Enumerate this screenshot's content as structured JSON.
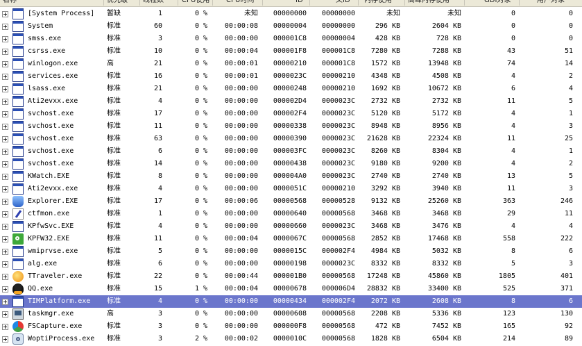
{
  "columns": [
    "名称",
    "优先级",
    "线程数",
    "CPU使用",
    "CPU时间",
    "ID",
    "父ID",
    "内存使用",
    "高峰内存使用",
    "GDI对象",
    "用户对象"
  ],
  "processes": [
    {
      "name": "[System Process]",
      "priority": "暂缺",
      "threads": "1",
      "cpu": "0 %",
      "cpu_time": "未知",
      "id": "00000000",
      "parent_id": "00000000",
      "mem": "未知",
      "peak_mem": "未知",
      "gdi": "0",
      "user": "0",
      "icon": "window-icon"
    },
    {
      "name": "System",
      "priority": "标准",
      "threads": "60",
      "cpu": "0 %",
      "cpu_time": "00:00:08",
      "id": "00000004",
      "parent_id": "00000000",
      "mem": "296 KB",
      "peak_mem": "2604 KB",
      "gdi": "0",
      "user": "0",
      "icon": "window-icon"
    },
    {
      "name": "smss.exe",
      "priority": "标准",
      "threads": "3",
      "cpu": "0 %",
      "cpu_time": "00:00:00",
      "id": "000001C8",
      "parent_id": "00000004",
      "mem": "428 KB",
      "peak_mem": "728 KB",
      "gdi": "0",
      "user": "0",
      "icon": "window-icon"
    },
    {
      "name": "csrss.exe",
      "priority": "标准",
      "threads": "10",
      "cpu": "0 %",
      "cpu_time": "00:00:04",
      "id": "000001F8",
      "parent_id": "000001C8",
      "mem": "7280 KB",
      "peak_mem": "7288 KB",
      "gdi": "43",
      "user": "51",
      "icon": "window-icon"
    },
    {
      "name": "winlogon.exe",
      "priority": "高",
      "threads": "21",
      "cpu": "0 %",
      "cpu_time": "00:00:01",
      "id": "00000210",
      "parent_id": "000001C8",
      "mem": "1572 KB",
      "peak_mem": "13948 KB",
      "gdi": "74",
      "user": "14",
      "icon": "window-icon"
    },
    {
      "name": "services.exe",
      "priority": "标准",
      "threads": "16",
      "cpu": "0 %",
      "cpu_time": "00:00:01",
      "id": "0000023C",
      "parent_id": "00000210",
      "mem": "4348 KB",
      "peak_mem": "4508 KB",
      "gdi": "4",
      "user": "2",
      "icon": "window-icon"
    },
    {
      "name": "lsass.exe",
      "priority": "标准",
      "threads": "21",
      "cpu": "0 %",
      "cpu_time": "00:00:00",
      "id": "00000248",
      "parent_id": "00000210",
      "mem": "1692 KB",
      "peak_mem": "10672 KB",
      "gdi": "6",
      "user": "4",
      "icon": "window-icon"
    },
    {
      "name": "Ati2evxx.exe",
      "priority": "标准",
      "threads": "4",
      "cpu": "0 %",
      "cpu_time": "00:00:00",
      "id": "000002D4",
      "parent_id": "0000023C",
      "mem": "2732 KB",
      "peak_mem": "2732 KB",
      "gdi": "11",
      "user": "5",
      "icon": "window-icon"
    },
    {
      "name": "svchost.exe",
      "priority": "标准",
      "threads": "17",
      "cpu": "0 %",
      "cpu_time": "00:00:00",
      "id": "000002F4",
      "parent_id": "0000023C",
      "mem": "5120 KB",
      "peak_mem": "5172 KB",
      "gdi": "4",
      "user": "1",
      "icon": "window-icon"
    },
    {
      "name": "svchost.exe",
      "priority": "标准",
      "threads": "11",
      "cpu": "0 %",
      "cpu_time": "00:00:00",
      "id": "00000338",
      "parent_id": "0000023C",
      "mem": "8948 KB",
      "peak_mem": "8956 KB",
      "gdi": "4",
      "user": "3",
      "icon": "window-icon"
    },
    {
      "name": "svchost.exe",
      "priority": "标准",
      "threads": "63",
      "cpu": "0 %",
      "cpu_time": "00:00:00",
      "id": "00000390",
      "parent_id": "0000023C",
      "mem": "21628 KB",
      "peak_mem": "22324 KB",
      "gdi": "11",
      "user": "25",
      "icon": "window-icon"
    },
    {
      "name": "svchost.exe",
      "priority": "标准",
      "threads": "6",
      "cpu": "0 %",
      "cpu_time": "00:00:00",
      "id": "000003FC",
      "parent_id": "0000023C",
      "mem": "8260 KB",
      "peak_mem": "8304 KB",
      "gdi": "4",
      "user": "1",
      "icon": "window-icon"
    },
    {
      "name": "svchost.exe",
      "priority": "标准",
      "threads": "14",
      "cpu": "0 %",
      "cpu_time": "00:00:00",
      "id": "00000438",
      "parent_id": "0000023C",
      "mem": "9180 KB",
      "peak_mem": "9200 KB",
      "gdi": "4",
      "user": "2",
      "icon": "window-icon"
    },
    {
      "name": "KWatch.EXE",
      "priority": "标准",
      "threads": "8",
      "cpu": "0 %",
      "cpu_time": "00:00:00",
      "id": "000004A0",
      "parent_id": "0000023C",
      "mem": "2740 KB",
      "peak_mem": "2740 KB",
      "gdi": "13",
      "user": "5",
      "icon": "window-icon"
    },
    {
      "name": "Ati2evxx.exe",
      "priority": "标准",
      "threads": "4",
      "cpu": "0 %",
      "cpu_time": "00:00:00",
      "id": "0000051C",
      "parent_id": "00000210",
      "mem": "3292 KB",
      "peak_mem": "3940 KB",
      "gdi": "11",
      "user": "3",
      "icon": "window-icon"
    },
    {
      "name": "Explorer.EXE",
      "priority": "标准",
      "threads": "17",
      "cpu": "0 %",
      "cpu_time": "00:00:06",
      "id": "00000568",
      "parent_id": "00000528",
      "mem": "9132 KB",
      "peak_mem": "25260 KB",
      "gdi": "363",
      "user": "246",
      "icon": "explorer-icon"
    },
    {
      "name": "ctfmon.exe",
      "priority": "标准",
      "threads": "1",
      "cpu": "0 %",
      "cpu_time": "00:00:00",
      "id": "00000640",
      "parent_id": "00000568",
      "mem": "3468 KB",
      "peak_mem": "3468 KB",
      "gdi": "29",
      "user": "11",
      "icon": "pen-icon"
    },
    {
      "name": "KPfwSvc.EXE",
      "priority": "标准",
      "threads": "4",
      "cpu": "0 %",
      "cpu_time": "00:00:00",
      "id": "00000660",
      "parent_id": "0000023C",
      "mem": "3468 KB",
      "peak_mem": "3476 KB",
      "gdi": "4",
      "user": "4",
      "icon": "window-icon"
    },
    {
      "name": "KPFW32.EXE",
      "priority": "标准",
      "threads": "11",
      "cpu": "0 %",
      "cpu_time": "00:00:04",
      "id": "0000067C",
      "parent_id": "00000568",
      "mem": "2852 KB",
      "peak_mem": "17468 KB",
      "gdi": "558",
      "user": "222",
      "icon": "firewall-icon"
    },
    {
      "name": "wmiprvse.exe",
      "priority": "标准",
      "threads": "5",
      "cpu": "0 %",
      "cpu_time": "00:00:00",
      "id": "0000015C",
      "parent_id": "000002F4",
      "mem": "4984 KB",
      "peak_mem": "5032 KB",
      "gdi": "8",
      "user": "6",
      "icon": "window-icon"
    },
    {
      "name": "alg.exe",
      "priority": "标准",
      "threads": "6",
      "cpu": "0 %",
      "cpu_time": "00:00:00",
      "id": "00000198",
      "parent_id": "0000023C",
      "mem": "8332 KB",
      "peak_mem": "8332 KB",
      "gdi": "5",
      "user": "3",
      "icon": "window-icon"
    },
    {
      "name": "TTraveler.exe",
      "priority": "标准",
      "threads": "22",
      "cpu": "0 %",
      "cpu_time": "00:00:44",
      "id": "000001B0",
      "parent_id": "00000568",
      "mem": "17248 KB",
      "peak_mem": "45860 KB",
      "gdi": "1805",
      "user": "401",
      "icon": "browser-icon"
    },
    {
      "name": "QQ.exe",
      "priority": "标准",
      "threads": "15",
      "cpu": "1 %",
      "cpu_time": "00:00:04",
      "id": "00000678",
      "parent_id": "000006D4",
      "mem": "28832 KB",
      "peak_mem": "33400 KB",
      "gdi": "525",
      "user": "371",
      "icon": "qq-penguin-icon"
    },
    {
      "name": "TIMPlatform.exe",
      "priority": "标准",
      "threads": "4",
      "cpu": "0 %",
      "cpu_time": "00:00:00",
      "id": "00000434",
      "parent_id": "000002F4",
      "mem": "2072 KB",
      "peak_mem": "2608 KB",
      "gdi": "8",
      "user": "6",
      "icon": "window-icon",
      "selected": true
    },
    {
      "name": "taskmgr.exe",
      "priority": "高",
      "threads": "3",
      "cpu": "0 %",
      "cpu_time": "00:00:00",
      "id": "00000608",
      "parent_id": "00000568",
      "mem": "2208 KB",
      "peak_mem": "5336 KB",
      "gdi": "123",
      "user": "130",
      "icon": "monitor-icon"
    },
    {
      "name": "FSCapture.exe",
      "priority": "标准",
      "threads": "3",
      "cpu": "0 %",
      "cpu_time": "00:00:00",
      "id": "000000F8",
      "parent_id": "00000568",
      "mem": "472 KB",
      "peak_mem": "7452 KB",
      "gdi": "165",
      "user": "92",
      "icon": "capture-icon"
    },
    {
      "name": "WoptiProcess.exe",
      "priority": "标准",
      "threads": "3",
      "cpu": "2 %",
      "cpu_time": "00:00:02",
      "id": "0000010C",
      "parent_id": "00000568",
      "mem": "1828 KB",
      "peak_mem": "6504 KB",
      "gdi": "214",
      "user": "89",
      "icon": "gear-icon"
    }
  ],
  "colors": {
    "selection": "#6b76cc",
    "header_bg": "#ece9d8"
  }
}
